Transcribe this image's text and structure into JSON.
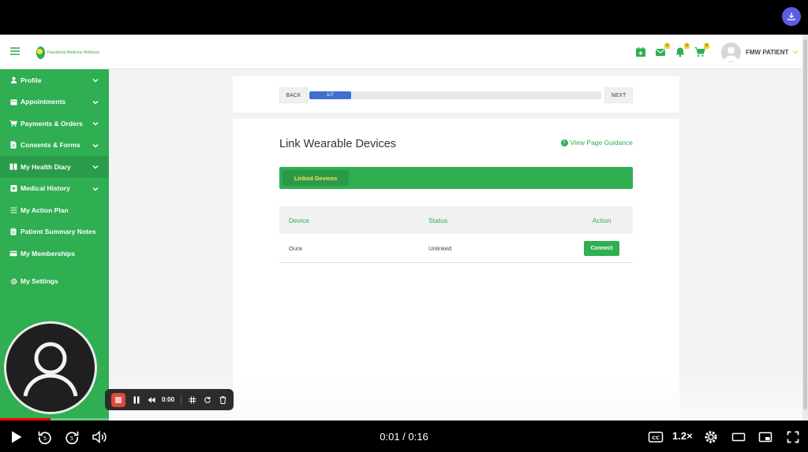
{
  "app": {
    "logo_text": "Functional Medicine Wellness",
    "user_name": "FMW PATIENT",
    "badges": {
      "messages": "0",
      "notifications": "0",
      "cart": "0"
    }
  },
  "sidebar": {
    "items": [
      {
        "label": "Profile",
        "icon": "user-icon",
        "expandable": true
      },
      {
        "label": "Appointments",
        "icon": "calendar-icon",
        "expandable": true
      },
      {
        "label": "Payments & Orders",
        "icon": "cart-icon",
        "expandable": true
      },
      {
        "label": "Consents & Forms",
        "icon": "document-icon",
        "expandable": true
      },
      {
        "label": "My Health Diary",
        "icon": "book-icon",
        "expandable": true,
        "active": true
      },
      {
        "label": "Medical History",
        "icon": "medical-icon",
        "expandable": true
      },
      {
        "label": "My Action Plan",
        "icon": "list-icon",
        "expandable": false
      },
      {
        "label": "Patient Summary Notes",
        "icon": "clipboard-icon",
        "expandable": false
      },
      {
        "label": "My Memberships",
        "icon": "card-icon",
        "expandable": false
      }
    ],
    "settings": {
      "label": "My Settings",
      "icon": "gear-icon"
    }
  },
  "stepper": {
    "back_label": "BACK",
    "next_label": "NEXT",
    "progress_text": "1/7",
    "progress_fraction": 0.1429
  },
  "main": {
    "title": "Link Wearable Devices",
    "guidance_label": "View Page Guidance",
    "tab_label": "Linked Devices",
    "table": {
      "headers": [
        "Device",
        "Status",
        "Action"
      ],
      "rows": [
        {
          "device": "Oura",
          "status": "Unlinked",
          "action": "Connect"
        }
      ]
    }
  },
  "recorder": {
    "time": "0:00"
  },
  "player": {
    "time_display": "0:01 / 0:16",
    "speed": "1.2×",
    "progress_fraction": 0.0625
  },
  "colors": {
    "brand_green": "#2fae52",
    "progress_blue": "#3e6fd1",
    "badge_yellow": "#f0d62c",
    "yt_red": "#ff0000"
  }
}
